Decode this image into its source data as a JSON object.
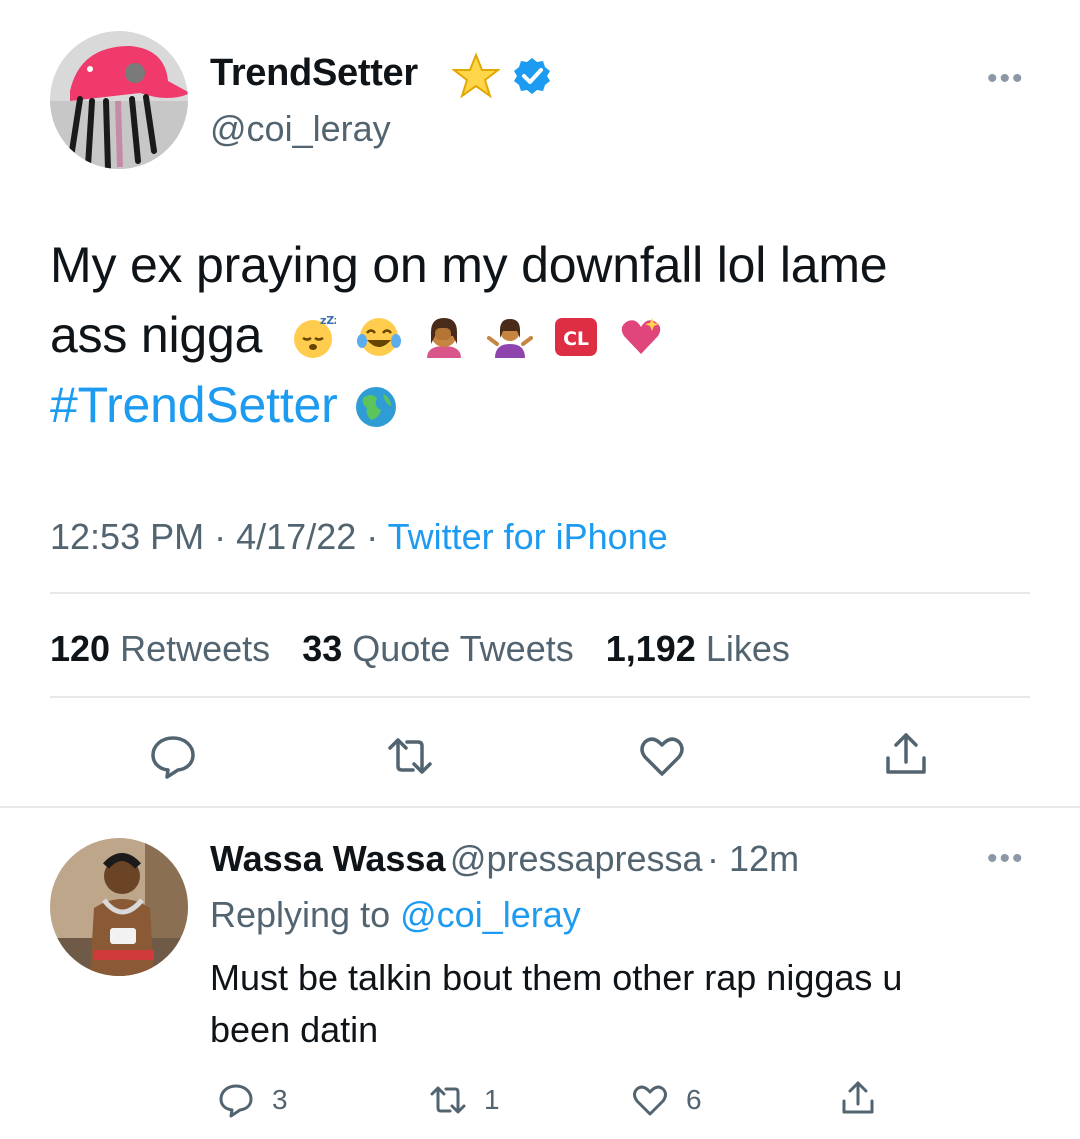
{
  "tweet": {
    "display_name": "TrendSetter",
    "handle": "@coi_leray",
    "text_line1": "My ex praying on my downfall lol lame",
    "text_line2": "ass nigga",
    "hashtag": "#TrendSetter",
    "emojis": [
      "sleeping-face-emoji",
      "tears-of-joy-emoji",
      "facepalm-emoji",
      "shrug-emoji",
      "cl-button-emoji",
      "sparkling-heart-emoji"
    ],
    "cl_label": "CL",
    "time": "12:53 PM",
    "date": "4/17/22",
    "source": "Twitter for iPhone",
    "separator": "·",
    "stats": {
      "retweets_count": "120",
      "retweets_label": "Retweets",
      "quotes_count": "33",
      "quotes_label": "Quote Tweets",
      "likes_count": "1,192",
      "likes_label": "Likes"
    },
    "more_label": "•••"
  },
  "reply": {
    "display_name": "Wassa Wassa",
    "handle": "@pressapressa",
    "time": "· 12m",
    "replying_to_label": "Replying to",
    "replying_to_handle": "@coi_leray",
    "text_line1": "Must be talkin bout them other rap niggas u",
    "text_line2": "been datin",
    "reply_count": "3",
    "retweet_count": "1",
    "like_count": "6",
    "more_label": "•••"
  },
  "colors": {
    "accent": "#1d9bf0",
    "text": "#0f1419",
    "muted": "#536471",
    "divider": "#e6e9ec",
    "verified": "#1d9bf0",
    "avatar_hat": "#ef3a6b"
  }
}
